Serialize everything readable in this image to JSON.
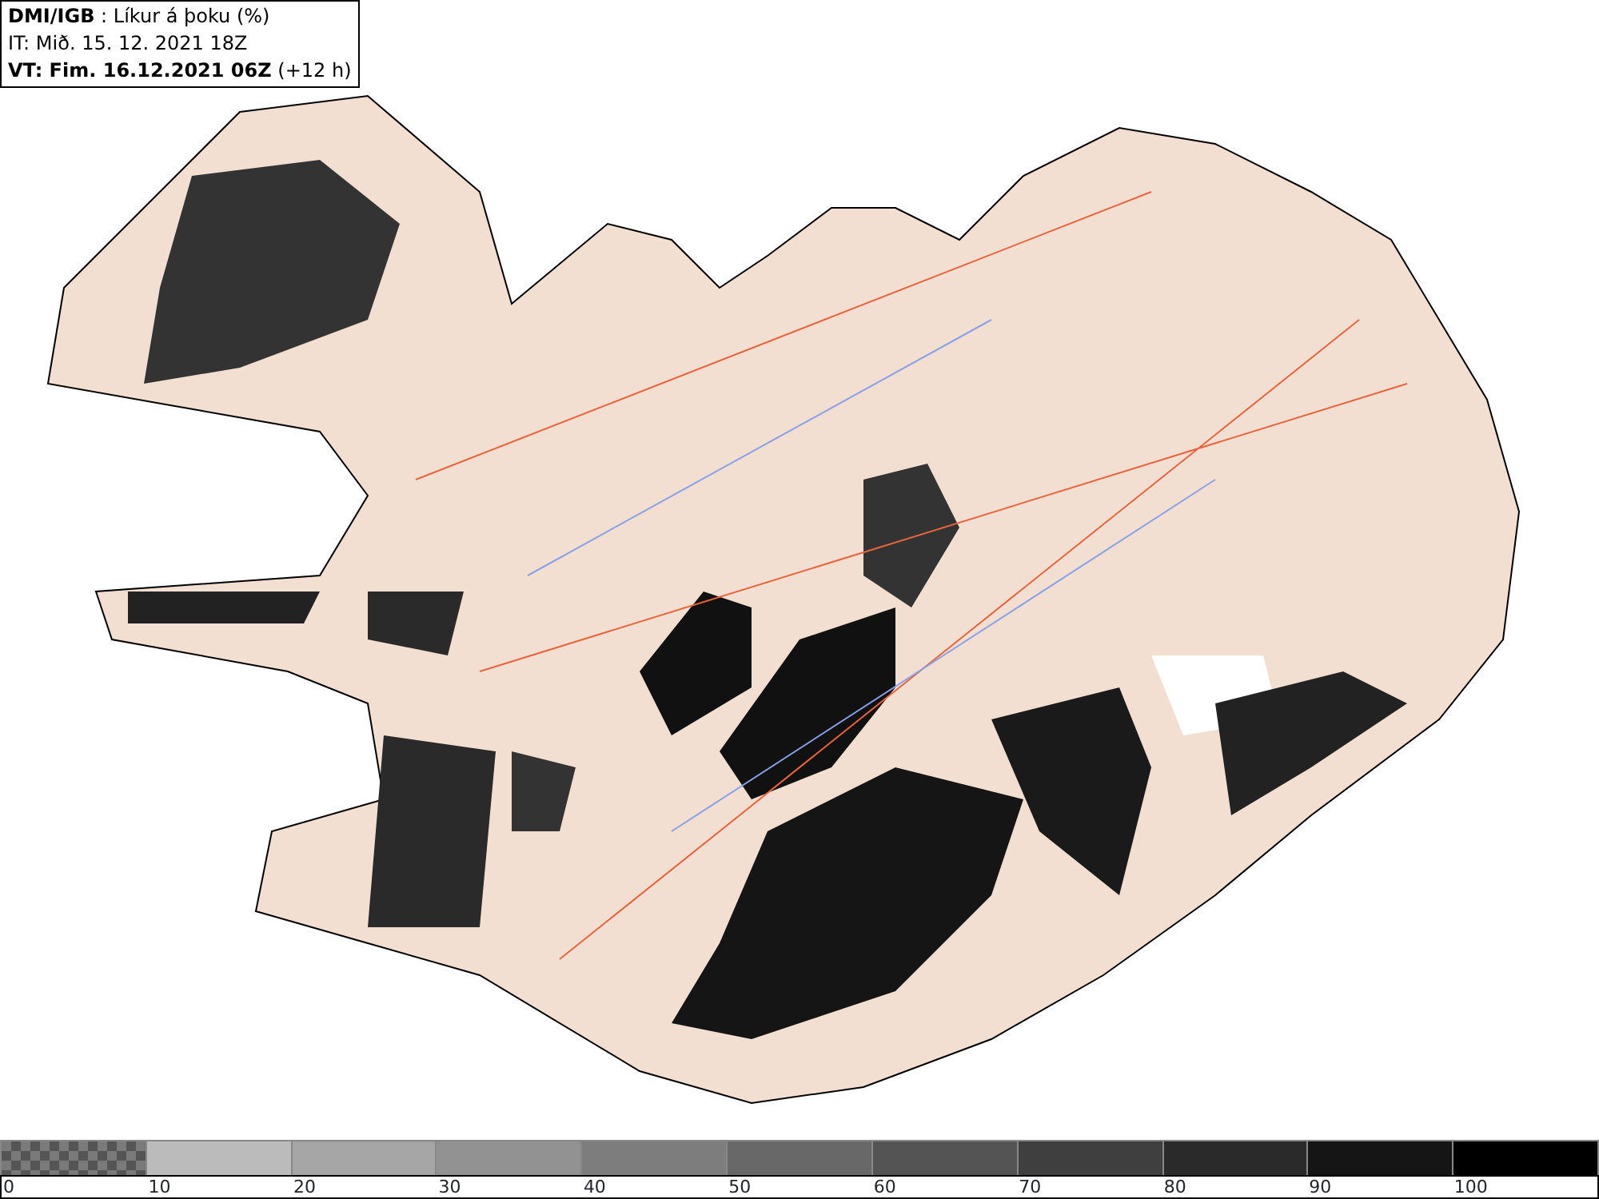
{
  "header": {
    "lines": [
      "**DMI/IGB** : Líkur á þoku (%)",
      "IT: Mið. 15. 12. 2021 18Z",
      "**VT: Fim. 16.12.2021 06Z** (+12 h)"
    ]
  },
  "legend": {
    "segments": [
      {
        "label": "0",
        "kind": "checkered",
        "color": "#7a7a7a"
      },
      {
        "label": "10",
        "kind": "solid",
        "color": "#bbbbbb"
      },
      {
        "label": "20",
        "kind": "solid",
        "color": "#a6a6a6"
      },
      {
        "label": "30",
        "kind": "solid",
        "color": "#929292"
      },
      {
        "label": "40",
        "kind": "solid",
        "color": "#7d7d7d"
      },
      {
        "label": "50",
        "kind": "solid",
        "color": "#686868"
      },
      {
        "label": "60",
        "kind": "solid",
        "color": "#545454"
      },
      {
        "label": "70",
        "kind": "solid",
        "color": "#3f3f3f"
      },
      {
        "label": "80",
        "kind": "solid",
        "color": "#2a2a2a"
      },
      {
        "label": "90",
        "kind": "solid",
        "color": "#151515"
      },
      {
        "label": "100",
        "kind": "solid",
        "color": "#000000"
      }
    ]
  }
}
